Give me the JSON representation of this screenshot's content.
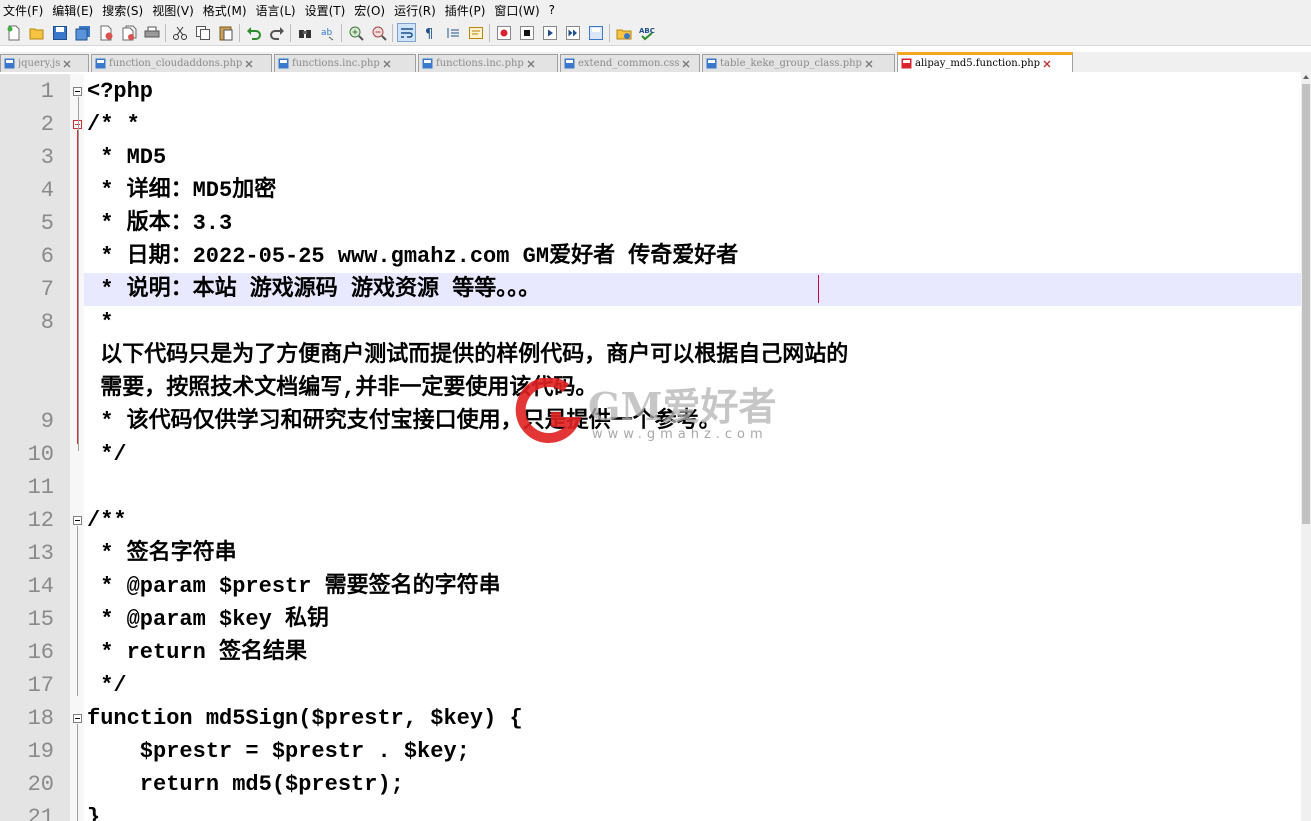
{
  "menu": [
    "文件(F)",
    "编辑(E)",
    "搜索(S)",
    "视图(V)",
    "格式(M)",
    "语言(L)",
    "设置(T)",
    "宏(O)",
    "运行(R)",
    "插件(P)",
    "窗口(W)",
    "?"
  ],
  "tabs": [
    {
      "label": "jquery.js",
      "active": false
    },
    {
      "label": "function_cloudaddons.php",
      "active": false
    },
    {
      "label": "functions.inc.php",
      "active": false
    },
    {
      "label": "functions.inc.php",
      "active": false
    },
    {
      "label": "extend_common.css",
      "active": false
    },
    {
      "label": "table_keke_group_class.php",
      "active": false
    },
    {
      "label": "alipay_md5.function.php",
      "active": true
    }
  ],
  "line_numbers": [
    "1",
    "2",
    "3",
    "4",
    "5",
    "6",
    "7",
    "8",
    "",
    "",
    "9",
    "10",
    "11",
    "12",
    "13",
    "14",
    "15",
    "16",
    "17",
    "18",
    "19",
    "20",
    "21"
  ],
  "code_lines": [
    "<?php",
    "/* *",
    " * MD5",
    " * 详细：MD5加密",
    " * 版本：3.3",
    " * 日期：2022-05-25 www.gmahz.com GM爱好者 传奇爱好者",
    " * 说明：本站 游戏源码 游戏资源 等等。。。",
    " *",
    " 以下代码只是为了方便商户测试而提供的样例代码，商户可以根据自己网站的",
    " 需要，按照技术文档编写,并非一定要使用该代码。",
    " * 该代码仅供学习和研究支付宝接口使用，只是提供一个参考。",
    " */",
    "",
    "/**",
    " * 签名字符串",
    " * @param $prestr 需要签名的字符串",
    " * @param $key 私钥",
    " * return 签名结果",
    " */",
    "function md5Sign($prestr, $key) {",
    "    $prestr = $prestr . $key;",
    "    return md5($prestr);",
    "}"
  ],
  "watermark": {
    "brand": "GM爱好者",
    "url": "www.gmahz.com"
  },
  "colors": {
    "current_line": "#e8e8ff",
    "active_tab_accent": "#f5a623",
    "gutter": "#e4e4e4",
    "caret": "#c00040"
  }
}
